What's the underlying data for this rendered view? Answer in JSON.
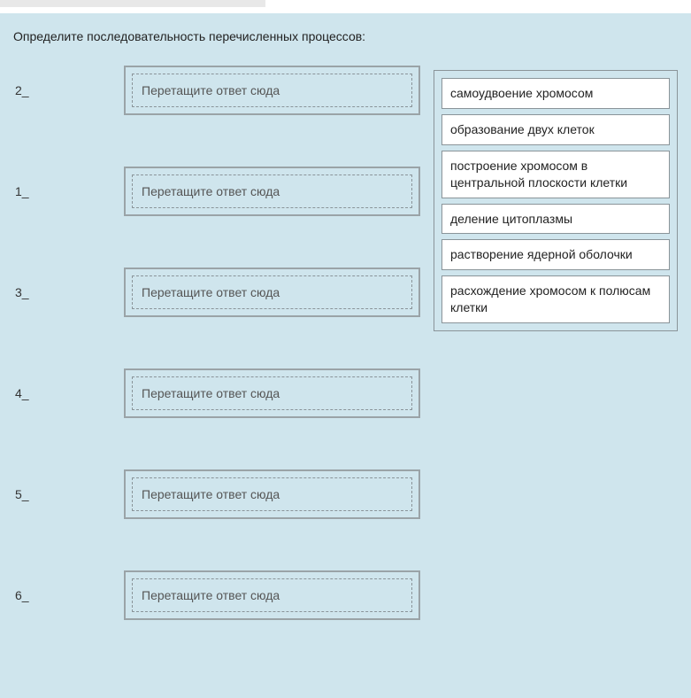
{
  "question": {
    "prompt": "Определите последовательность перечисленных процессов:"
  },
  "rows": [
    {
      "label": "2_",
      "placeholder": "Перетащите ответ сюда"
    },
    {
      "label": "1_",
      "placeholder": "Перетащите ответ сюда"
    },
    {
      "label": "3_",
      "placeholder": "Перетащите ответ сюда"
    },
    {
      "label": "4_",
      "placeholder": "Перетащите ответ сюда"
    },
    {
      "label": "5_",
      "placeholder": "Перетащите ответ сюда"
    },
    {
      "label": "6_",
      "placeholder": "Перетащите ответ сюда"
    }
  ],
  "options": [
    "самоудвоение хромосом",
    "образование двух клеток",
    "построение хромосом в центральной плоскости клетки",
    "деление цитоплазмы",
    "растворение ядерной оболочки",
    "расхождение хромосом к полюсам клетки"
  ]
}
